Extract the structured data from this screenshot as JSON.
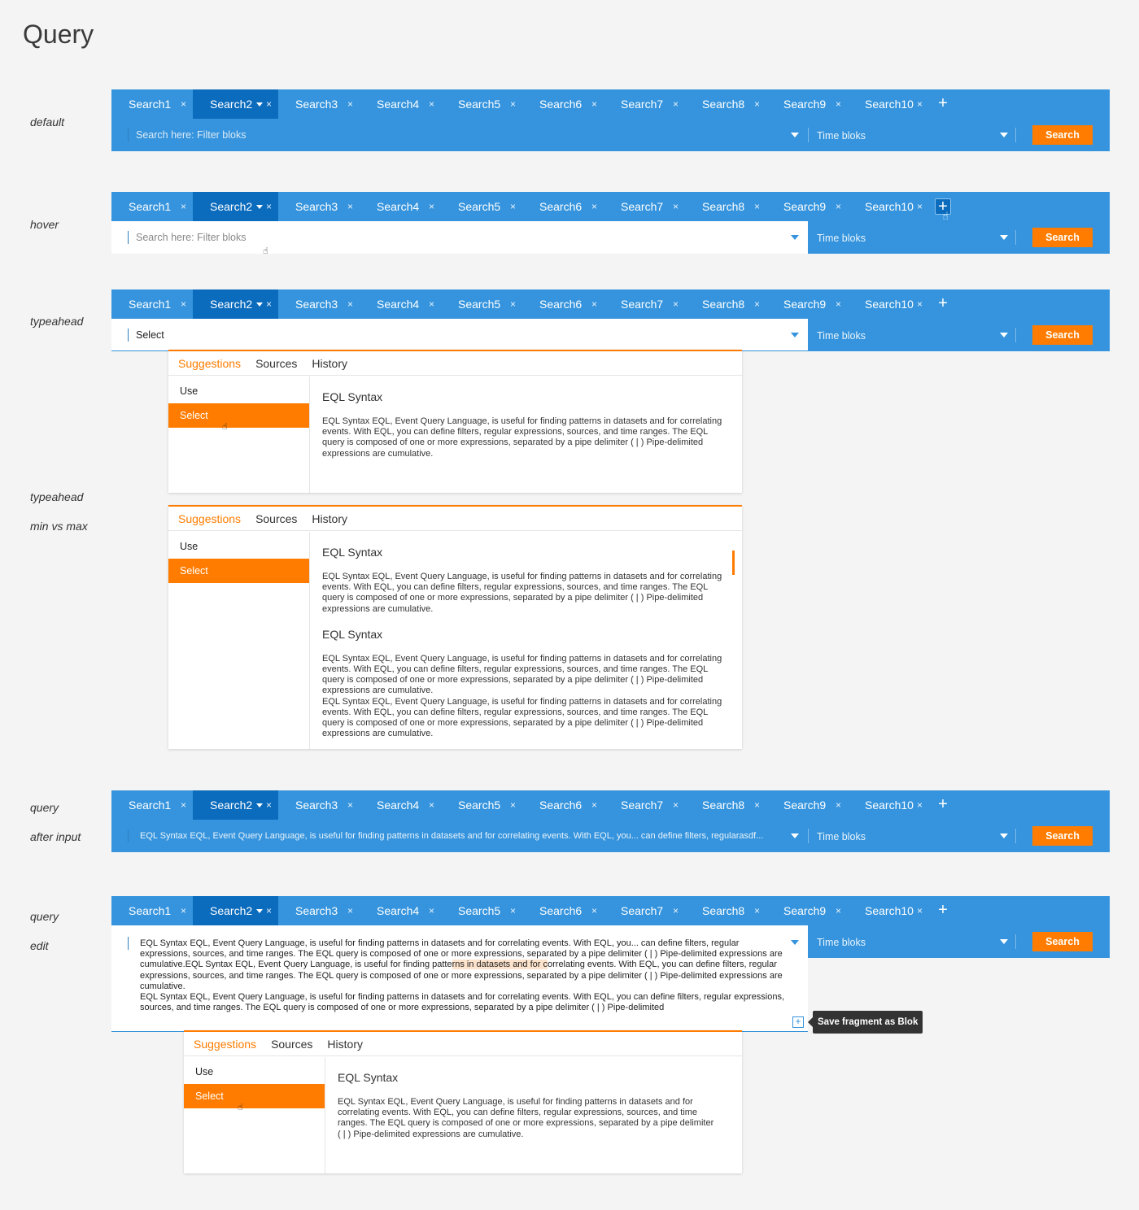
{
  "page_title": "Query",
  "tabs": [
    {
      "label": "Search1",
      "active": false
    },
    {
      "label": "Search2",
      "active": true
    },
    {
      "label": "Search3",
      "active": false
    },
    {
      "label": "Search4",
      "active": false
    },
    {
      "label": "Search5",
      "active": false
    },
    {
      "label": "Search6",
      "active": false
    },
    {
      "label": "Search7",
      "active": false
    },
    {
      "label": "Search8",
      "active": false
    },
    {
      "label": "Search9",
      "active": false
    },
    {
      "label": "Search10",
      "active": false
    }
  ],
  "close_glyph": "×",
  "add_glyph": "+",
  "query_placeholder": "Search here: Filter bloks",
  "time_placeholder": "Time bloks",
  "search_label": "Search",
  "states": {
    "default": "default",
    "hover": "hover",
    "typeahead": "typeahead",
    "typeahead_minmax_1": "typeahead",
    "typeahead_minmax_2": "min vs max",
    "query_after_1": "query",
    "query_after_2": "after input",
    "query_edit_1": "query",
    "query_edit_2": "edit"
  },
  "typeahead_value": "Select",
  "panel": {
    "tabs": [
      "Suggestions",
      "Sources",
      "History"
    ],
    "items": [
      "Use",
      "Select"
    ],
    "heading": "EQL Syntax",
    "body": "EQL Syntax EQL, Event Query Language, is useful for finding patterns in datasets and for correlating events. With EQL, you can define filters, regular expressions, sources, and time ranges. The EQL query is composed of one or more expressions, separated by a pipe delimiter ( | ) Pipe-delimited expressions are cumulative."
  },
  "query_after_text": "EQL Syntax EQL, Event Query Language, is useful for finding patterns in datasets and for correlating events. With EQL, you... can define filters, regularasdf...",
  "query_edit": {
    "part1": "EQL Syntax EQL, Event Query Language, is useful for finding patterns in datasets and for correlating events. With EQL, you... can define filters, regular expressions, sources, and time ranges. The EQL query is composed of one or more expressions, separated by a pipe delimiter ( | ) Pipe-delimited expressions are cumulative.EQL Syntax EQL, Event Query Language, is useful for finding patte",
    "highlight": "rns in datasets and for c",
    "part2": "orrelating events. With EQL, you can define filters, regular expressions, sources, and time ranges. The EQL query is composed of one or more expressions, separated by a pipe delimiter ( | ) Pipe-delimited expressions are cumulative.",
    "part3": "EQL Syntax EQL, Event Query Language, is useful for finding patterns in datasets and for correlating events. With EQL, you can define filters, regular expressions, sources, and time ranges. The EQL query is composed of one or more expressions, separated by a pipe delimiter ( | ) Pipe-delimited"
  },
  "save_icon_glyph": "+",
  "tooltip": "Save fragment as Blok",
  "pointer_glyph": "☝",
  "colors": {
    "primary": "#3594dd",
    "active_tab": "#0b6bbd",
    "accent": "#ff7c00",
    "background": "#f4f4f4"
  }
}
